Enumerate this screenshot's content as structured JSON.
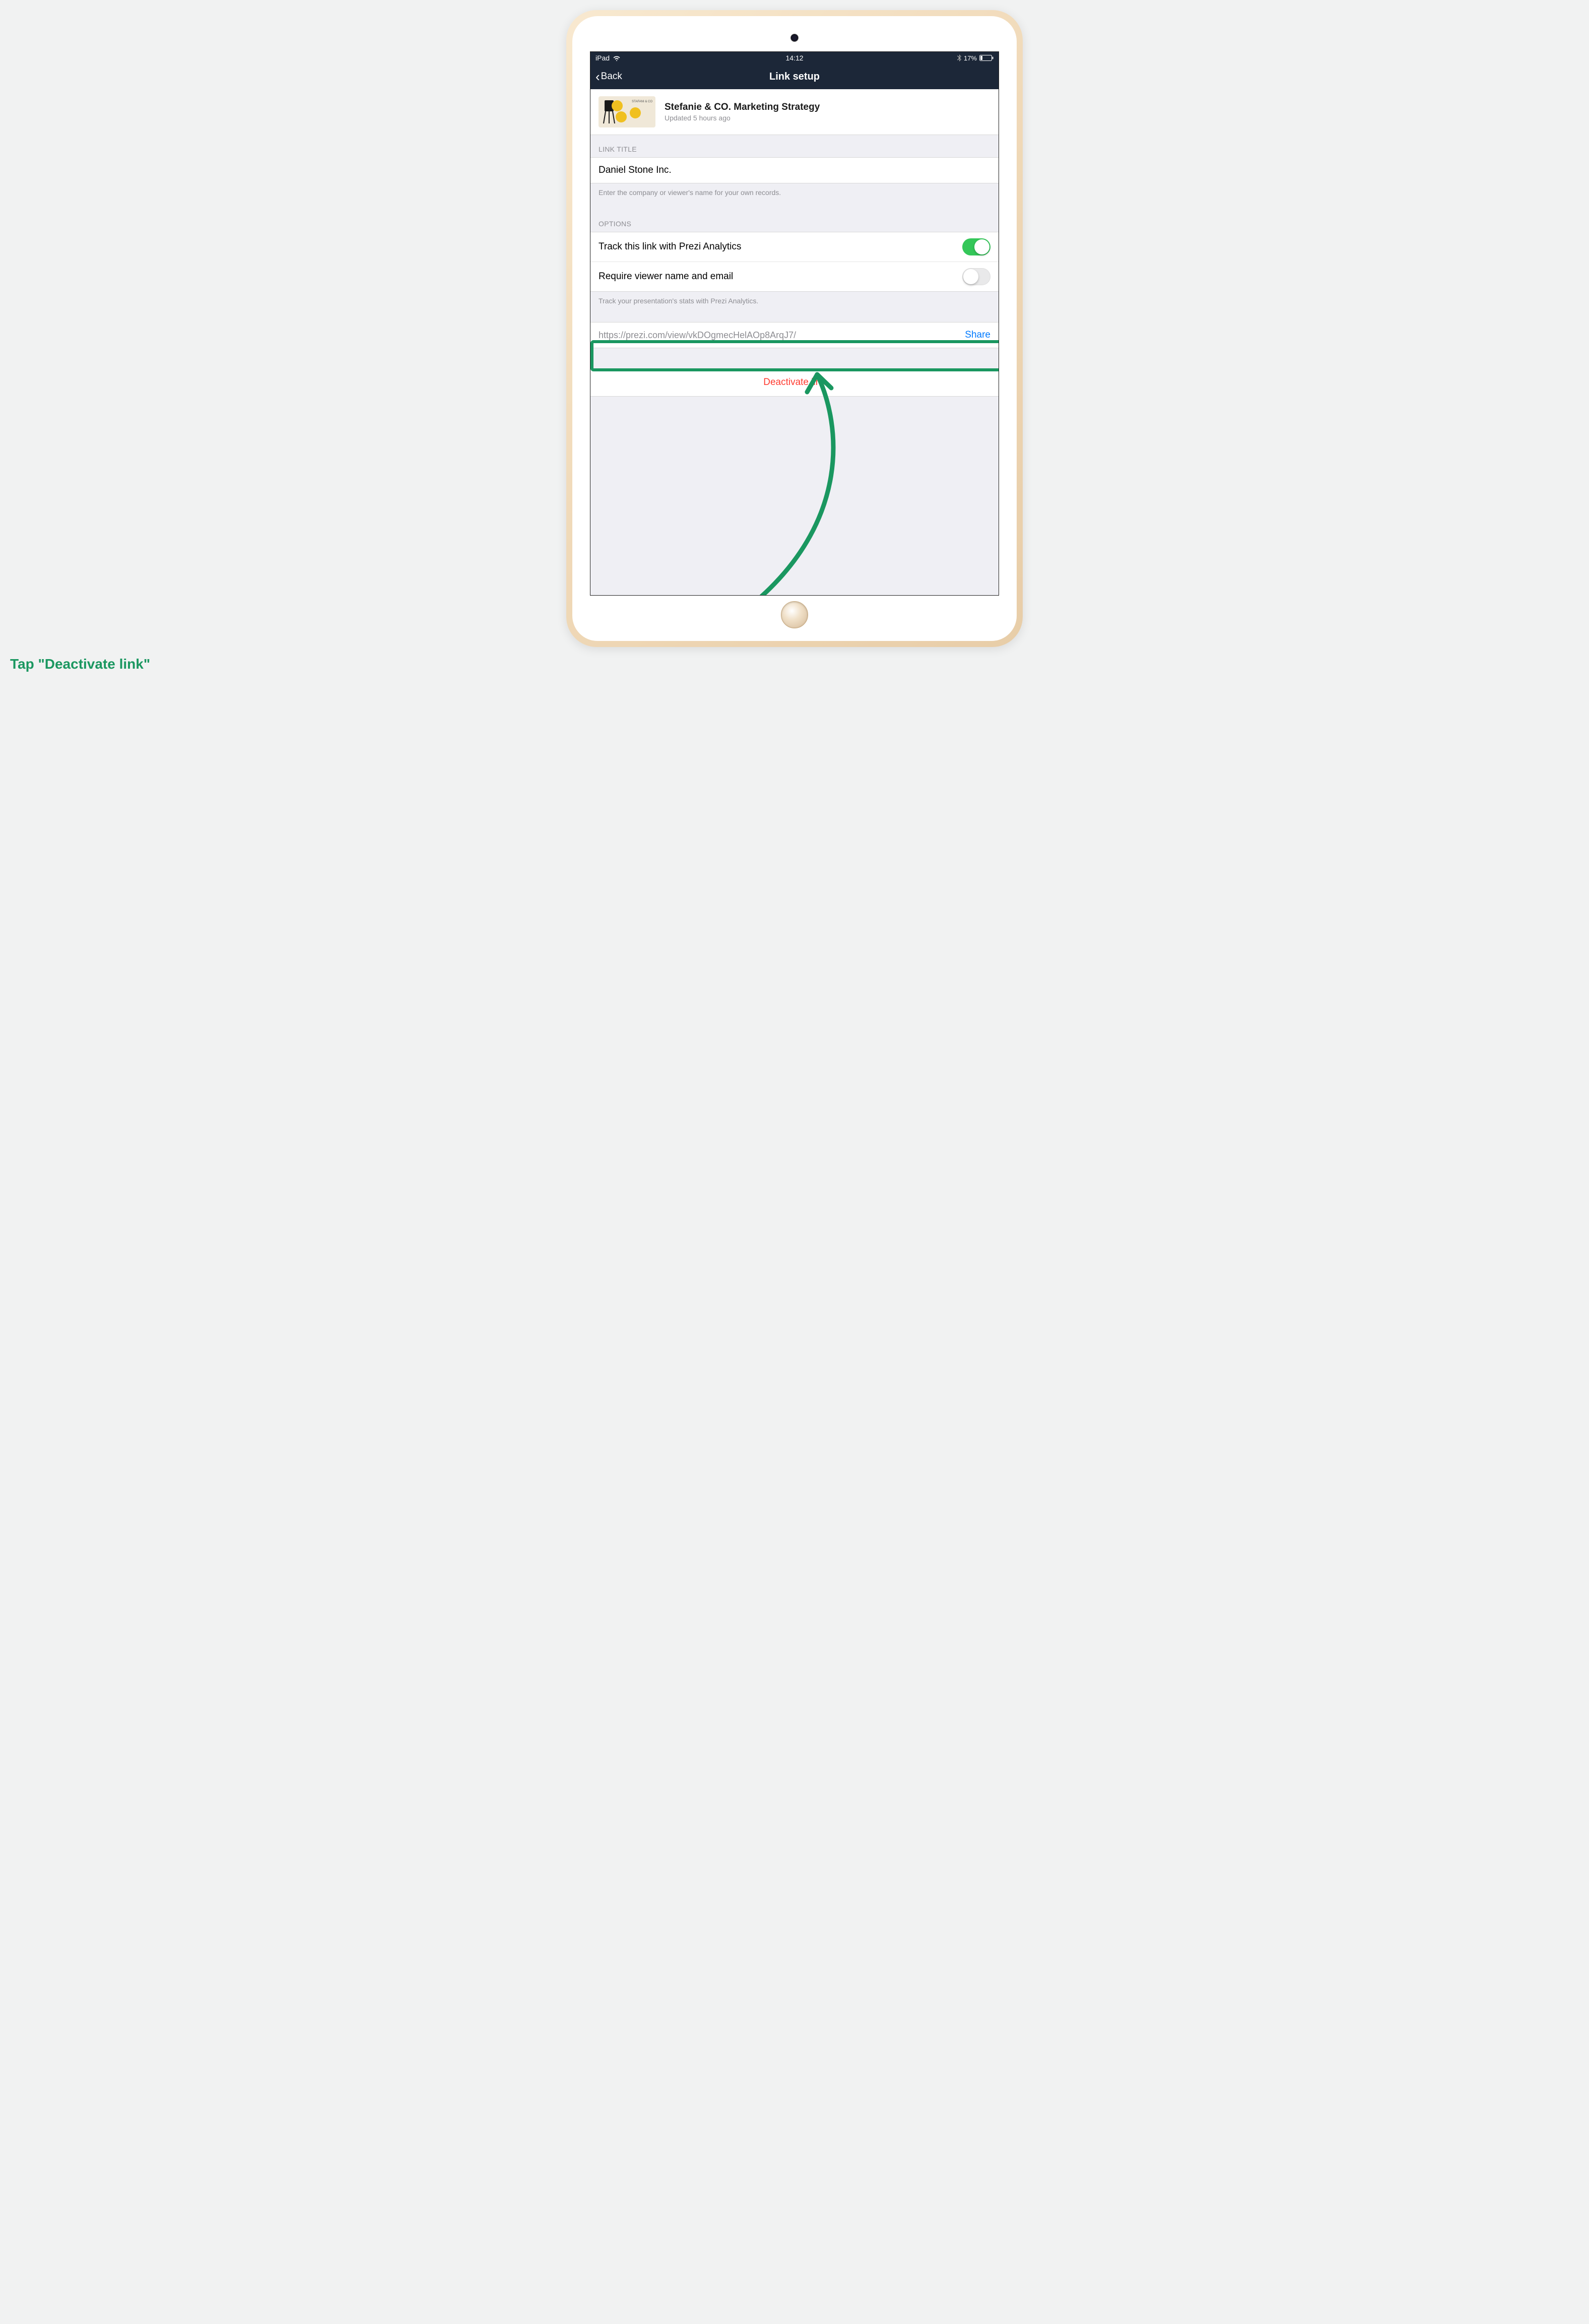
{
  "status_bar": {
    "device_label": "iPad",
    "time": "14:12",
    "battery_percent": "17%"
  },
  "nav": {
    "back_label": "Back",
    "title": "Link setup"
  },
  "presentation": {
    "title": "Stefanie & CO. Marketing Strategy",
    "updated": "Updated 5 hours ago"
  },
  "sections": {
    "link_title_header": "LINK TITLE",
    "link_title_value": "Daniel Stone Inc.",
    "link_title_helper": "Enter the company or viewer's name for your own records.",
    "options_header": "OPTIONS",
    "options_helper": "Track your presentation's stats with Prezi Analytics."
  },
  "options": {
    "track_label": "Track this link with Prezi Analytics",
    "track_enabled": true,
    "require_label": "Require viewer name and email",
    "require_enabled": false
  },
  "url_row": {
    "url": "https://prezi.com/view/vkDOgmecHelAOp8ArqJ7/",
    "share_label": "Share"
  },
  "deactivate": {
    "label": "Deactivate link"
  },
  "annotation": {
    "caption": "Tap \"Deactivate link\""
  },
  "colors": {
    "nav_bg": "#1c2738",
    "accent_green": "#1a9760",
    "toggle_on": "#34c759",
    "ios_blue": "#007aff",
    "ios_red": "#ff3b30"
  }
}
